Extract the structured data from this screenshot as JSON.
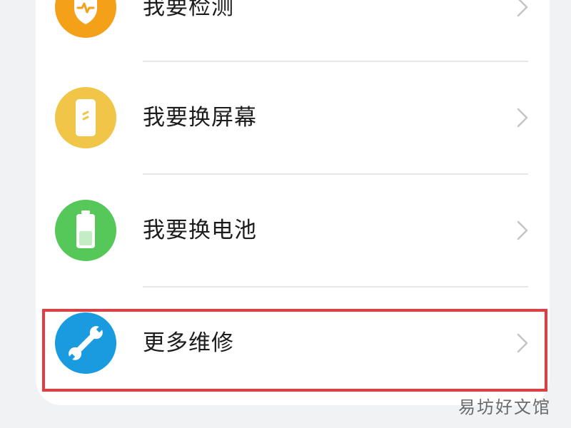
{
  "menu": {
    "items": [
      {
        "label": "我要检测",
        "icon": "shield-wave-icon",
        "color": "#f5a019"
      },
      {
        "label": "我要换屏幕",
        "icon": "phone-screen-icon",
        "color": "#f1c547"
      },
      {
        "label": "我要换电池",
        "icon": "battery-icon",
        "color": "#56c85a"
      },
      {
        "label": "更多维修",
        "icon": "wrench-icon",
        "color": "#1a9be0"
      }
    ],
    "chevron_icon": "chevron-right-icon"
  },
  "highlight": {
    "color": "#e63a3f",
    "target": "更多维修"
  },
  "watermark": "易坊好文馆"
}
